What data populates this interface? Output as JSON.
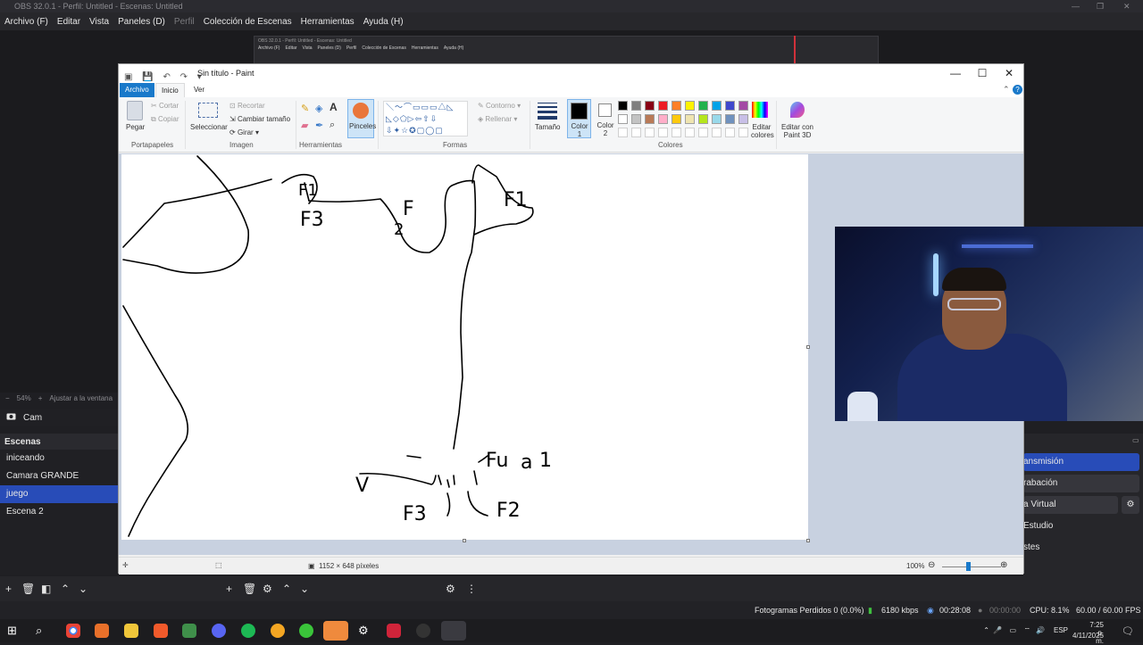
{
  "obs": {
    "title": "OBS 32.0.1 - Perfil: Untitled - Escenas: Untitled",
    "window_controls": [
      "—",
      "❐",
      "✕"
    ],
    "menu": [
      "Archivo (F)",
      "Editar",
      "Vista",
      "Paneles (D)",
      "Perfil",
      "Colección de Escenas",
      "Herramientas",
      "Ayuda (H)"
    ],
    "nested_title": "OBS 32.0.1 - Perfil: Untitled - Escenas: Untitled",
    "nested_menu": [
      "Archivo (F)",
      "Editar",
      "Vista",
      "Paneles (D)",
      "Perfil",
      "Colección de Escenas",
      "Herramientas",
      "Ayuda (H)"
    ],
    "zoom": "54%",
    "fit_window": "Ajustar a la ventana",
    "source_name": "Cam",
    "scenes_header": "Escenas",
    "scenes": [
      {
        "name": "iniceando",
        "active": false
      },
      {
        "name": "Camara GRANDE",
        "active": false
      },
      {
        "name": "juego",
        "active": true
      },
      {
        "name": "Escena 2",
        "active": false
      }
    ],
    "controls": [
      {
        "label": "ansmisión",
        "highlight": true
      },
      {
        "label": "rabación",
        "highlight": false
      },
      {
        "label": "a Virtual",
        "highlight": false
      },
      {
        "label": "Estudio",
        "highlight": false
      },
      {
        "label": "stes",
        "highlight": false
      }
    ],
    "status": {
      "dropped_frames": "Fotogramas Perdidos 0 (0.0%)",
      "bitrate": "6180 kbps",
      "stream_time": "00:28:08",
      "rec_time": "00:00:00",
      "cpu": "CPU: 8.1%",
      "fps": "60.00 / 60.00 FPS"
    }
  },
  "paint": {
    "title": "Sin título - Paint",
    "tabs": {
      "file": "Archivo",
      "home": "Inicio",
      "view": "Ver"
    },
    "clipboard": {
      "paste": "Pegar",
      "cut": "Cortar",
      "copy": "Copiar",
      "label": "Portapapeles"
    },
    "image": {
      "select": "Seleccionar",
      "crop": "Recortar",
      "resize": "Cambiar tamaño",
      "rotate": "Girar",
      "label": "Imagen"
    },
    "tools": {
      "label": "Herramientas"
    },
    "brushes": "Pinceles",
    "shapes": {
      "outline": "Contorno",
      "fill": "Rellenar",
      "label": "Formas"
    },
    "size": "Tamaño",
    "color1": "Color 1",
    "color2": "Color 2",
    "colors_label": "Colores",
    "edit_colors": "Editar colores",
    "paint3d": "Editar con Paint 3D",
    "palette": [
      "#000000",
      "#7f7f7f",
      "#880015",
      "#ed1c24",
      "#ff7f27",
      "#fff200",
      "#22b14c",
      "#00a2e8",
      "#3f48cc",
      "#a349a4",
      "#ffffff",
      "#c3c3c3",
      "#b97a57",
      "#ffaec9",
      "#ffc90e",
      "#efe4b0",
      "#b5e61d",
      "#99d9ea",
      "#7092be",
      "#c8bfe7"
    ],
    "canvas_size": "1152 × 648 píxeles",
    "zoom": "100%",
    "drawing_labels": [
      "F1",
      "F3",
      "F",
      "2",
      "F1",
      "Fu",
      "a",
      "1",
      "V",
      "F3",
      "F2"
    ]
  },
  "taskbar": {
    "lang": "ESP",
    "time": "7:25 p. m.",
    "date": "4/11/2025"
  }
}
